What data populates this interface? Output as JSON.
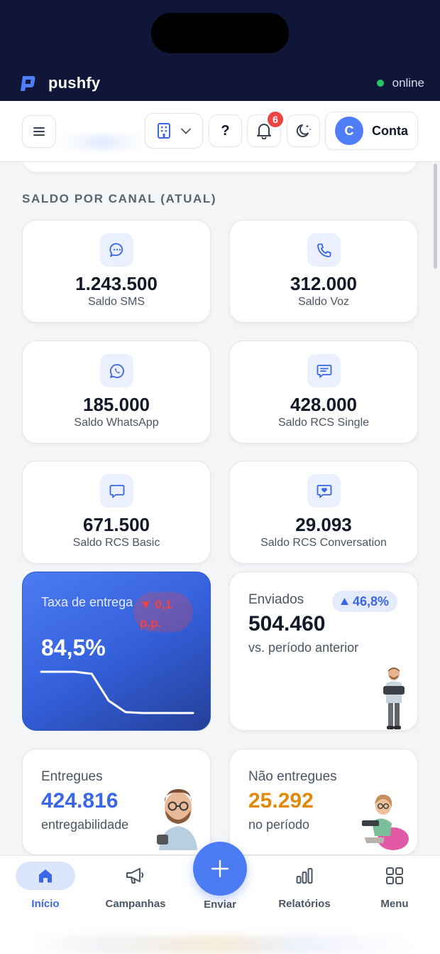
{
  "app": {
    "name": "pushfy",
    "status": "online"
  },
  "header": {
    "notification_count": "6",
    "account": {
      "initial": "C",
      "label": "Conta"
    },
    "help_label": "?"
  },
  "section_title": "SALDO POR CANAL (ATUAL)",
  "channels": [
    {
      "value": "1.243.500",
      "label": "Saldo SMS",
      "icon": "chat-bubble-icon"
    },
    {
      "value": "312.000",
      "label": "Saldo Voz",
      "icon": "phone-icon"
    },
    {
      "value": "185.000",
      "label": "Saldo WhatsApp",
      "icon": "whatsapp-icon"
    },
    {
      "value": "428.000",
      "label": "Saldo RCS Single",
      "icon": "message-lines-icon"
    },
    {
      "value": "671.500",
      "label": "Saldo RCS Basic",
      "icon": "message-square-icon"
    },
    {
      "value": "29.093",
      "label": "Saldo RCS Conversation",
      "icon": "heart-message-icon"
    }
  ],
  "delivery_rate": {
    "title": "Taxa de entrega",
    "delta": "▼ 0,1 p.p.",
    "value": "84,5%",
    "sparkline": [
      1,
      1,
      1,
      0.95,
      0.3,
      0.02,
      0,
      0,
      0,
      0
    ]
  },
  "sent": {
    "title": "Enviados",
    "trend": "46,8%",
    "value": "504.460",
    "subtitle": "vs. período anterior"
  },
  "delivered": {
    "title": "Entregues",
    "value": "424.816",
    "subtitle": "entregabilidade"
  },
  "undelivered": {
    "title": "Não entregues",
    "value": "25.292",
    "subtitle": "no período"
  },
  "nav": {
    "home": "Início",
    "campaigns": "Campanhas",
    "send": "Enviar",
    "reports": "Relatórios",
    "menu": "Menu"
  },
  "colors": {
    "brand_blue": "#4c7cf3",
    "status_online": "#22c55e",
    "negative": "#ef4444",
    "delivered_value": "#3b66e8",
    "undelivered_value": "#e08a0b"
  }
}
